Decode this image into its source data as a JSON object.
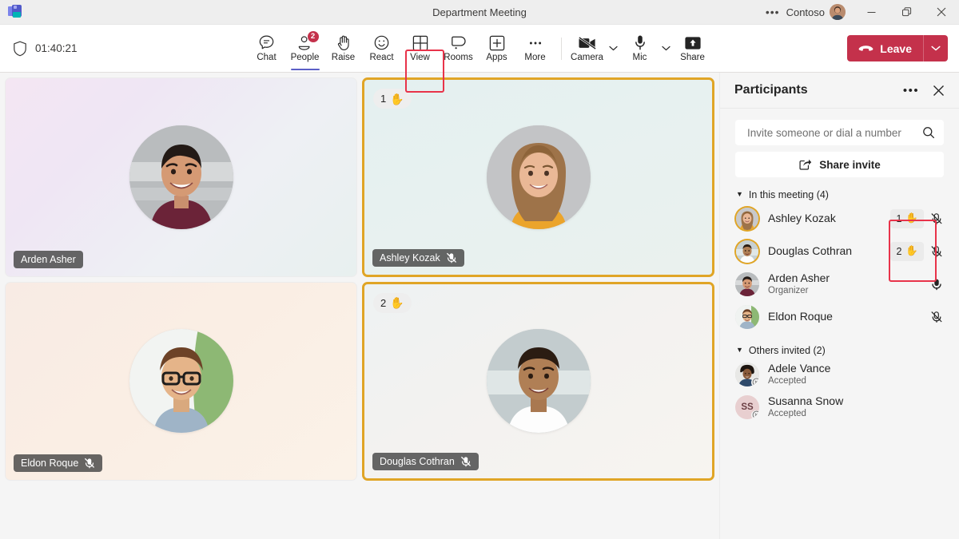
{
  "titlebar": {
    "logo_icon": "teams-logo-icon",
    "meeting_title": "Department Meeting",
    "overflow_icon": "more-options-icon",
    "overflow_label": "•••",
    "org_name": "Contoso",
    "avatar_icon": "user-avatar",
    "minimize_icon": "minimize-icon",
    "maximize_icon": "maximize-icon",
    "close_icon": "close-icon"
  },
  "toolbar": {
    "shield_icon": "shield-icon",
    "timer": "01:40:21",
    "buttons": [
      {
        "label": "Chat",
        "icon": "chat-icon",
        "badge": null,
        "active": false
      },
      {
        "label": "People",
        "icon": "people-icon",
        "badge": "2",
        "active": true
      },
      {
        "label": "Raise",
        "icon": "raise-hand-icon",
        "badge": null,
        "active": false
      },
      {
        "label": "React",
        "icon": "react-icon",
        "badge": null,
        "active": false
      },
      {
        "label": "View",
        "icon": "view-grid-icon",
        "badge": null,
        "active": false
      },
      {
        "label": "Rooms",
        "icon": "breakout-rooms-icon",
        "badge": null,
        "active": false
      },
      {
        "label": "Apps",
        "icon": "apps-plus-icon",
        "badge": null,
        "active": false
      },
      {
        "label": "More",
        "icon": "more-ellipsis-icon",
        "badge": null,
        "active": false
      }
    ],
    "camera": {
      "label": "Camera",
      "icon": "camera-off-icon",
      "state": "off",
      "chevron_icon": "chevron-down-icon"
    },
    "mic": {
      "label": "Mic",
      "icon": "microphone-icon",
      "state": "on",
      "chevron_icon": "chevron-down-icon"
    },
    "share": {
      "label": "Share",
      "icon": "share-screen-icon"
    },
    "leave": {
      "label": "Leave",
      "icon": "hangup-icon",
      "chevron_icon": "chevron-down-icon",
      "color": "#c4314b"
    }
  },
  "stage": {
    "tiles": [
      {
        "name": "Arden Asher",
        "muted": false,
        "hand_raised": false,
        "hand_order": null,
        "avatar": "arden-asher-avatar"
      },
      {
        "name": "Ashley Kozak",
        "muted": true,
        "hand_raised": true,
        "hand_order": "1",
        "avatar": "ashley-kozak-avatar"
      },
      {
        "name": "Eldon Roque",
        "muted": true,
        "hand_raised": false,
        "hand_order": null,
        "avatar": "eldon-roque-avatar"
      },
      {
        "name": "Douglas Cothran",
        "muted": true,
        "hand_raised": true,
        "hand_order": "2",
        "avatar": "douglas-cothran-avatar"
      }
    ],
    "hand_glyph": "✋"
  },
  "panel": {
    "title": "Participants",
    "more_icon": "more-options-icon",
    "more_label": "•••",
    "close_icon": "close-icon",
    "invite_placeholder": "Invite someone or dial a number",
    "invite_value": "",
    "search_icon": "search-icon",
    "share_invite_label": "Share invite",
    "share_invite_icon": "share-invite-icon",
    "sections": [
      {
        "heading": "In this meeting (4)",
        "caret_icon": "chevron-down-icon",
        "people": [
          {
            "name": "Ashley Kozak",
            "role": null,
            "ring": true,
            "initials": null,
            "hand_order": "1",
            "mic": "muted",
            "declined": false
          },
          {
            "name": "Douglas Cothran",
            "role": null,
            "ring": true,
            "initials": null,
            "hand_order": "2",
            "mic": "muted",
            "declined": false
          },
          {
            "name": "Arden Asher",
            "role": "Organizer",
            "ring": false,
            "initials": null,
            "hand_order": null,
            "mic": "unmuted",
            "declined": false
          },
          {
            "name": "Eldon Roque",
            "role": null,
            "ring": false,
            "initials": null,
            "hand_order": null,
            "mic": "muted",
            "declined": false
          }
        ]
      },
      {
        "heading": "Others invited (2)",
        "caret_icon": "chevron-down-icon",
        "people": [
          {
            "name": "Adele Vance",
            "role": "Accepted",
            "ring": false,
            "initials": null,
            "hand_order": null,
            "mic": null,
            "declined": true
          },
          {
            "name": "Susanna Snow",
            "role": "Accepted",
            "ring": false,
            "initials": "SS",
            "hand_order": null,
            "mic": null,
            "declined": true
          }
        ]
      }
    ],
    "hand_glyph": "✋"
  },
  "annotations": {
    "people_button_highlight": "#e8334a",
    "hand_chips_highlight": "#e8334a",
    "raised_hand_border": "#e0a526"
  }
}
